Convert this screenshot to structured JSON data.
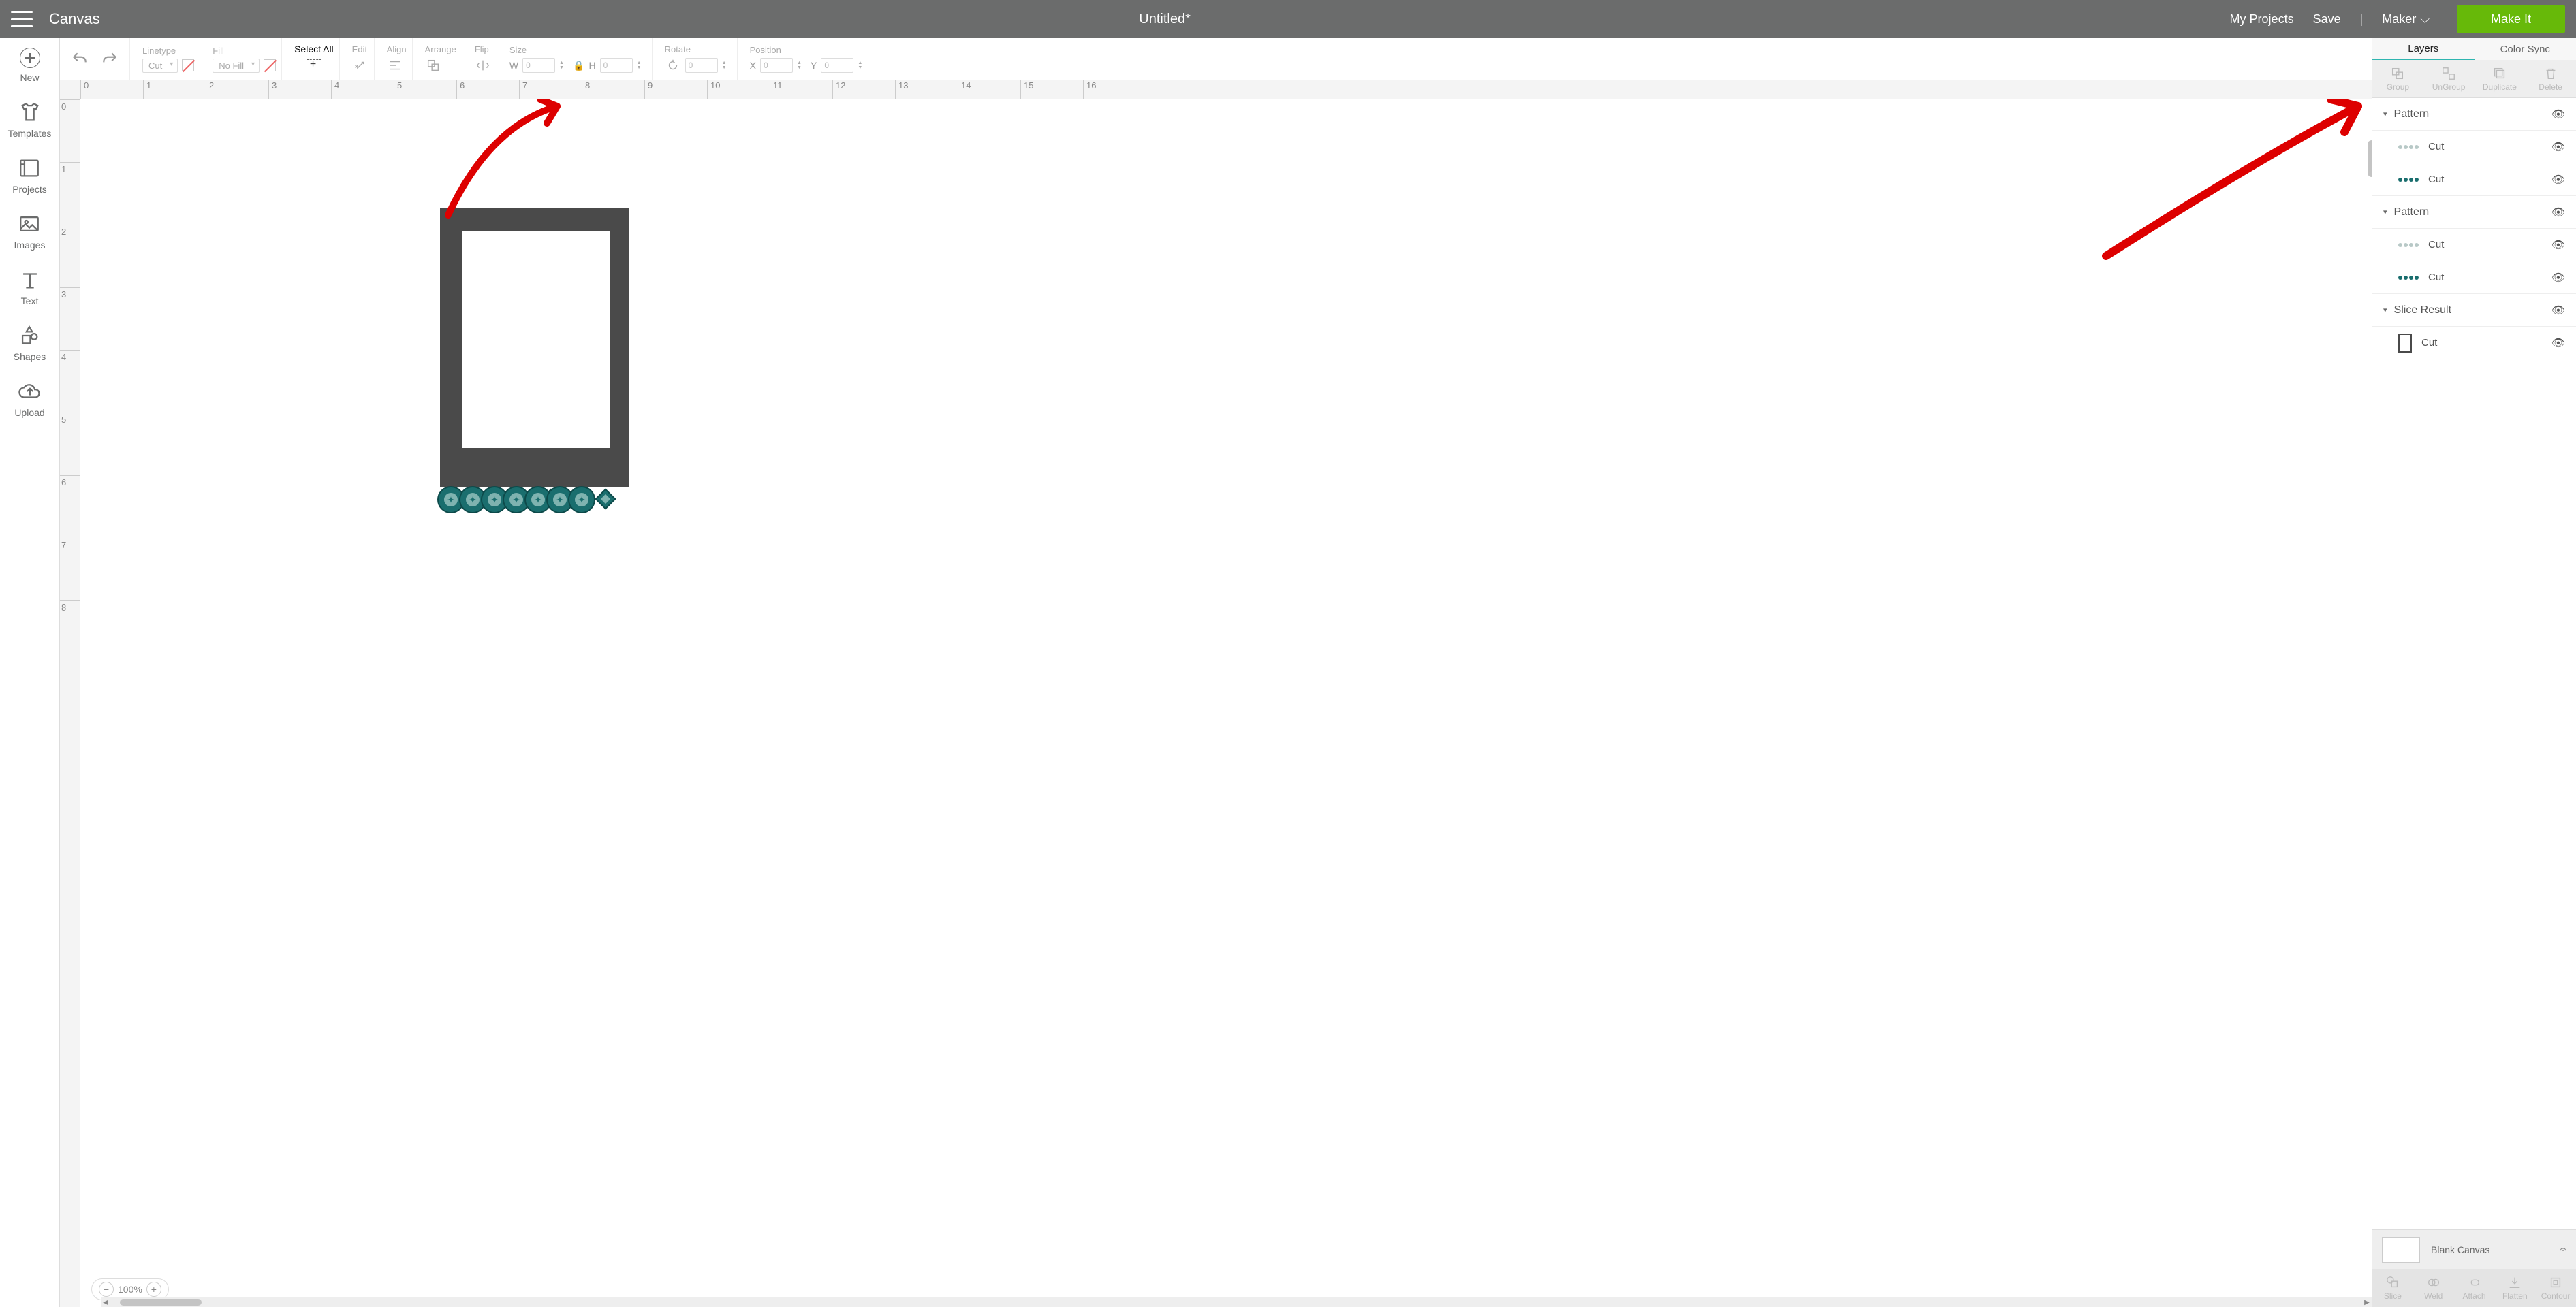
{
  "header": {
    "app_title": "Canvas",
    "doc_title": "Untitled*",
    "my_projects": "My Projects",
    "save": "Save",
    "separator": "|",
    "machine": "Maker",
    "make_it": "Make It"
  },
  "leftrail": {
    "new": "New",
    "templates": "Templates",
    "projects": "Projects",
    "images": "Images",
    "text": "Text",
    "shapes": "Shapes",
    "upload": "Upload"
  },
  "toolbar": {
    "linetype": {
      "label": "Linetype",
      "value": "Cut"
    },
    "fill": {
      "label": "Fill",
      "value": "No Fill"
    },
    "select_all": "Select All",
    "edit": "Edit",
    "align": "Align",
    "arrange": "Arrange",
    "flip": "Flip",
    "size": {
      "label": "Size",
      "w_label": "W",
      "h_label": "H",
      "w": "0",
      "h": "0"
    },
    "rotate": {
      "label": "Rotate",
      "value": "0"
    },
    "position": {
      "label": "Position",
      "x_label": "X",
      "y_label": "Y",
      "x": "0",
      "y": "0"
    }
  },
  "ruler_h": [
    "0",
    "1",
    "2",
    "3",
    "4",
    "5",
    "6",
    "7",
    "8",
    "9",
    "10",
    "11",
    "12",
    "13",
    "14",
    "15",
    "16"
  ],
  "ruler_v": [
    "0",
    "1",
    "2",
    "3",
    "4",
    "5",
    "6",
    "7",
    "8"
  ],
  "zoom": {
    "minus": "−",
    "value": "100%",
    "plus": "+"
  },
  "rightpanel": {
    "tabs": {
      "layers": "Layers",
      "color_sync": "Color Sync"
    },
    "actions": {
      "group": "Group",
      "ungroup": "UnGroup",
      "duplicate": "Duplicate",
      "delete": "Delete"
    },
    "groups": [
      {
        "name": "Pattern",
        "rows": [
          {
            "label": "Cut",
            "swatch": "dots-lt"
          },
          {
            "label": "Cut",
            "swatch": "dots-dk"
          }
        ]
      },
      {
        "name": "Pattern",
        "rows": [
          {
            "label": "Cut",
            "swatch": "dots-lt"
          },
          {
            "label": "Cut",
            "swatch": "dots-dk"
          }
        ]
      },
      {
        "name": "Slice Result",
        "rows": [
          {
            "label": "Cut",
            "swatch": "rect"
          }
        ]
      }
    ],
    "blank_canvas": "Blank Canvas",
    "footer": {
      "slice": "Slice",
      "weld": "Weld",
      "attach": "Attach",
      "flatten": "Flatten",
      "contour": "Contour"
    }
  }
}
